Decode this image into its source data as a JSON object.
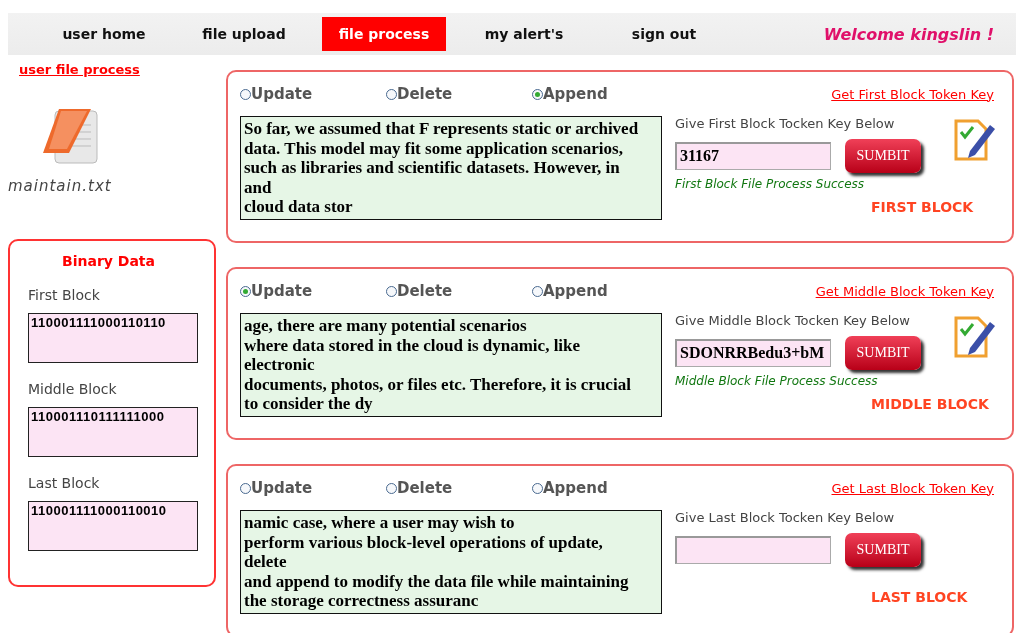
{
  "nav": {
    "items": [
      {
        "label": "user home",
        "selected": false
      },
      {
        "label": "file upload",
        "selected": false
      },
      {
        "label": "file process",
        "selected": true
      },
      {
        "label": "my alert's",
        "selected": false
      },
      {
        "label": "sign out",
        "selected": false
      }
    ],
    "welcome": "Welcome kingslin !"
  },
  "sidebar": {
    "link": "user file process",
    "file_name": "maintain.txt",
    "binary": {
      "title": "Binary Data",
      "blocks": [
        {
          "label": "First Block",
          "value": "110001111000110110"
        },
        {
          "label": "Middle Block",
          "value": "110001110111111000"
        },
        {
          "label": "Last Block",
          "value": "110001111000110010"
        }
      ]
    }
  },
  "blocks": [
    {
      "options": [
        {
          "label": "Update",
          "selected": false
        },
        {
          "label": "Delete",
          "selected": false
        },
        {
          "label": "Append",
          "selected": true
        }
      ],
      "content": "So far, we assumed that F represents static or archived\ndata. This model may fit some application scenarios,\nsuch as libraries and scientific datasets. However, in\nand\ncloud data stor",
      "token_link": "Get First Block Token Key",
      "key_label": "Give First Block Tocken Key Below",
      "key_value": "31167",
      "submit": "SUMBIT",
      "status": "First Block File Process Success",
      "block_label": "FIRST BLOCK",
      "verified": true
    },
    {
      "options": [
        {
          "label": "Update",
          "selected": true
        },
        {
          "label": "Delete",
          "selected": false
        },
        {
          "label": "Append",
          "selected": false
        }
      ],
      "content": "age, there are many potential scenarios\nwhere data stored in the cloud is dynamic, like\nelectronic\ndocuments, photos, or files etc. Therefore, it is crucial\nto consider the dy",
      "token_link": "Get Middle Block Token Key",
      "key_label": "Give Middle Block Tocken Key Below",
      "key_value": "SDONRRBedu3+bM",
      "submit": "SUMBIT",
      "status": "Middle Block File Process Success",
      "block_label": "MIDDLE BLOCK",
      "verified": true
    },
    {
      "options": [
        {
          "label": "Update",
          "selected": false
        },
        {
          "label": "Delete",
          "selected": false
        },
        {
          "label": "Append",
          "selected": false
        }
      ],
      "content": "namic case, where a user may wish to\nperform various block-level operations of update,\ndelete\nand append to modify the data file while maintaining\nthe storage correctness assuranc",
      "token_link": "Get Last Block Token Key",
      "key_label": "Give Last Block Tocken Key Below",
      "submit": "SUMBIT",
      "block_label": "LAST BLOCK",
      "verified": false
    }
  ]
}
